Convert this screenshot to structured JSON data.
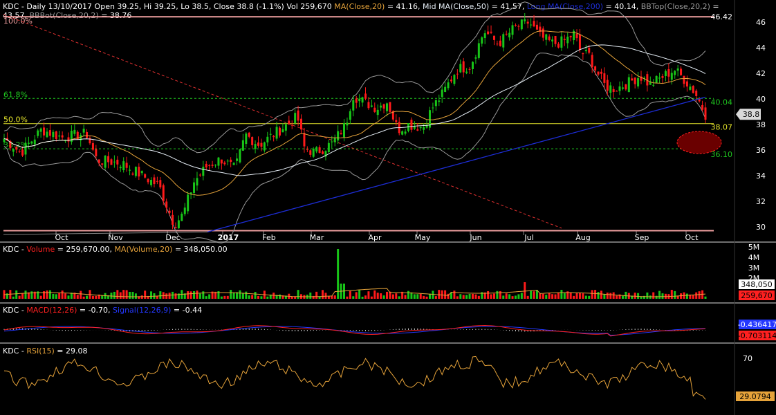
{
  "colors": {
    "background": "#000000",
    "panel_border": "#6f6f6f",
    "grid_text": "#ffffff",
    "up": "#18c518",
    "down": "#ff1a1a",
    "ma20": "#e6a33a",
    "ma50": "#e6eef6",
    "ma200": "#1d2dd6",
    "bbands": "#9a9a9a",
    "fib_green": "#1fc71f",
    "fib_yellow": "#e6e62a",
    "fib_line": "#f0a0a0",
    "trend_red": "#e03030",
    "macd": "#ff2020",
    "signal": "#2438ff",
    "rsi": "#e6a33a",
    "volume_ma": "#e6a33a",
    "ellipse": "#6a0000"
  },
  "main_panel": {
    "header_parts": [
      {
        "text": "KDC - Daily 13/10/2017 Open 39.25, Hi 39.25, Lo 38.5, Close 38.8 (-1.1%) Vol 259,670 ",
        "color": "#ffffff"
      },
      {
        "text": "MA(Close,20)",
        "color": "#e6a33a"
      },
      {
        "text": " = 41.16, ",
        "color": "#ffffff"
      },
      {
        "text": "Mid MA(Close,50)",
        "color": "#e6eef6"
      },
      {
        "text": " = 41.57, ",
        "color": "#ffffff"
      },
      {
        "text": "Long MA(Close,200)",
        "color": "#1d2dd6"
      },
      {
        "text": " = 40.14, ",
        "color": "#ffffff"
      },
      {
        "text": "BBTop(Close,20,2)",
        "color": "#9a9a9a"
      },
      {
        "text": " =",
        "color": "#ffffff"
      }
    ],
    "header_line2_parts": [
      {
        "text": "43.57, ",
        "color": "#ffffff"
      },
      {
        "text": "BBBot(Close,20,2)",
        "color": "#9a9a9a"
      },
      {
        "text": " = 38.76",
        "color": "#ffffff"
      }
    ],
    "y_ticks": [
      "30",
      "32",
      "34",
      "36",
      "38",
      "40",
      "42",
      "44",
      "46"
    ],
    "x_labels": [
      "Oct",
      "Nov",
      "Dec",
      "2017",
      "Feb",
      "Mar",
      "Apr",
      "May",
      "Jun",
      "Jul",
      "Aug",
      "Sep",
      "Oct"
    ],
    "fib_levels": [
      {
        "pct": "100.0%",
        "value": 46.42,
        "price_label": "46.42",
        "style": "pink"
      },
      {
        "pct": "61.8%",
        "value": 40.04,
        "price_label": "40.04",
        "style": "green"
      },
      {
        "pct": "50.0%",
        "value": 38.07,
        "price_label": "38.07",
        "style": "yellow"
      },
      {
        "pct": "38.2%",
        "value": 36.1,
        "price_label": "36.10",
        "style": "green"
      },
      {
        "pct": "",
        "value": 29.7,
        "price_label": "",
        "style": "pink"
      }
    ],
    "last_price_tag": "38.8"
  },
  "volume_panel": {
    "header_parts": [
      {
        "text": "KDC - ",
        "color": "#ffffff"
      },
      {
        "text": "Volume",
        "color": "#ff2020"
      },
      {
        "text": " = 259,670.00, ",
        "color": "#ffffff"
      },
      {
        "text": "MA(Volume,20)",
        "color": "#e6a33a"
      },
      {
        "text": " = 348,050.00",
        "color": "#ffffff"
      }
    ],
    "y_ticks": [
      "2M",
      "3M",
      "4M",
      "5M"
    ],
    "tags": [
      {
        "text": "348,050",
        "bg": "#ffffff",
        "fg": "#000000"
      },
      {
        "text": "259,670",
        "bg": "#ff2020",
        "fg": "#000000"
      }
    ]
  },
  "macd_panel": {
    "header_parts": [
      {
        "text": "KDC - ",
        "color": "#ffffff"
      },
      {
        "text": "MACD(12,26)",
        "color": "#ff2020"
      },
      {
        "text": " = -0.70, ",
        "color": "#ffffff"
      },
      {
        "text": "Signal(12,26,9)",
        "color": "#2438ff"
      },
      {
        "text": " = -0.44",
        "color": "#ffffff"
      }
    ],
    "tags": [
      {
        "text": "-0.436417",
        "bg": "#2438ff",
        "fg": "#ffffff"
      },
      {
        "text": "-0.703114",
        "bg": "#ff2020",
        "fg": "#000000"
      }
    ]
  },
  "rsi_panel": {
    "header_parts": [
      {
        "text": "KDC - ",
        "color": "#ffffff"
      },
      {
        "text": "RSI(15)",
        "color": "#e6a33a"
      },
      {
        "text": " = 29.08",
        "color": "#ffffff"
      }
    ],
    "y_ticks": [
      "70"
    ],
    "tag": {
      "text": "29.0794",
      "bg": "#e6a33a",
      "fg": "#000000"
    }
  },
  "chart_data": {
    "type": "line",
    "title": "KDC - Daily 13/10/2017",
    "ylim": [
      29.5,
      46.8
    ],
    "x": [
      "Sep",
      "Oct",
      "Nov",
      "Dec",
      "2017",
      "Feb",
      "Mar",
      "Apr",
      "May",
      "Jun",
      "Jul",
      "Aug",
      "Sep",
      "Oct"
    ],
    "series": [
      {
        "name": "Close",
        "values": [
          37.0,
          37.8,
          35.5,
          30.2,
          35.3,
          38.0,
          36.2,
          40.2,
          38.8,
          44.3,
          45.2,
          43.5,
          42.0,
          38.8
        ]
      },
      {
        "name": "MA(Close,20)",
        "values": [
          36.5,
          37.5,
          35.8,
          31.5,
          34.5,
          37.5,
          37.0,
          39.5,
          38.5,
          43.0,
          45.0,
          44.0,
          42.5,
          41.16
        ]
      },
      {
        "name": "Mid MA(Close,50)",
        "values": [
          31.0,
          35.5,
          36.5,
          35.0,
          33.8,
          35.5,
          36.5,
          38.5,
          38.0,
          41.5,
          43.8,
          44.0,
          42.5,
          41.57
        ]
      },
      {
        "name": "Long MA(Close,200)",
        "values": [
          29.3,
          29.3,
          29.3,
          29.3,
          29.8,
          31.4,
          33.0,
          34.5,
          35.6,
          36.6,
          37.3,
          38.3,
          39.3,
          40.14
        ]
      }
    ],
    "volume_ma": 348050,
    "volume_last": 259670,
    "macd_last": -0.7,
    "signal_last": -0.44,
    "rsi_last": 29.08,
    "fib_levels": [
      46.42,
      40.04,
      38.07,
      36.1
    ],
    "grid": false,
    "legend": "top-left"
  }
}
